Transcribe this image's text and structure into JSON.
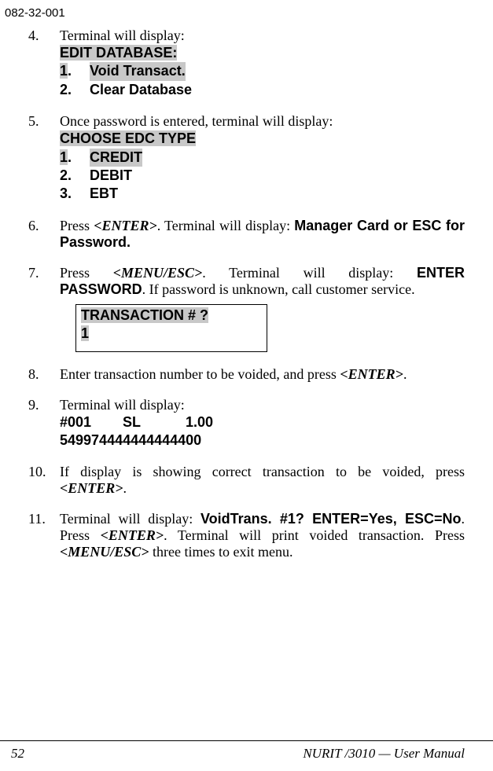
{
  "header": {
    "doc_code": "082-32-001"
  },
  "item4": {
    "num": "4.",
    "intro": "Terminal will display:",
    "title": "EDIT DATABASE:",
    "opt1num": "1",
    "opt1dot": ".",
    "opt1": "Void Transact.",
    "opt2num": "2",
    "opt2dot": ".",
    "opt2": "Clear Database"
  },
  "item5": {
    "num": "5.",
    "intro": "Once password is entered, terminal will display:",
    "title": " CHOOSE EDC TYPE",
    "opt1num": "1",
    "opt1dot": ".",
    "opt1": "CREDIT",
    "opt2num": "2",
    "opt2dot": ".",
    "opt2": "DEBIT",
    "opt3num": "3",
    "opt3dot": ".",
    "opt3": "EBT"
  },
  "item6": {
    "num": "6.",
    "t1": "Press ",
    "enter": "<ENTER>",
    "t2": ". Terminal will display: ",
    "msg": "Manager Card or ESC for Password."
  },
  "item7": {
    "num": "7.",
    "t1": "Press ",
    "menu": "<MENU/ESC>",
    "t2": ". Terminal will display: ",
    "msg": "ENTER PASSWORD",
    "t3": ".  If password is unknown, call customer service."
  },
  "box": {
    "line1": "TRANSACTION #  ?",
    "line2": "1"
  },
  "item8": {
    "num": "8.",
    "t1": "Enter transaction number to be voided, and press ",
    "enter": "<ENTER>",
    "t2": "."
  },
  "item9": {
    "num": "9.",
    "intro": "Terminal will display:",
    "row1a": "#001",
    "row1b": "SL",
    "row1c": "1.00",
    "row2": "549974444444444400"
  },
  "item10": {
    "num": "10.",
    "t1": "If display is showing correct transaction to be voided, press ",
    "enter": "<ENTER>",
    "t2": "."
  },
  "item11": {
    "num": "11.",
    "t1": "Terminal will display:  ",
    "msg": "VoidTrans. #1? ENTER=Yes, ESC=No",
    "t2": ". Press ",
    "enter": "<ENTER>",
    "t3": ". Terminal will print voided transaction.  Press ",
    "menu": "<MENU/ESC>",
    "t4": " three times to exit menu."
  },
  "footer": {
    "page": "52",
    "title": "NURIT /3010 — User Manual"
  }
}
